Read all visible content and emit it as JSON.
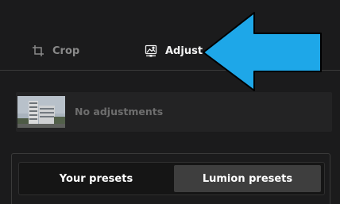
{
  "tabs": {
    "crop": {
      "label": "Crop",
      "icon": "crop-icon"
    },
    "adjust": {
      "label": "Adjust",
      "icon": "image-adjust-icon"
    }
  },
  "adjustments": {
    "status": "No adjustments"
  },
  "presets": {
    "your_label": "Your presets",
    "lumion_label": "Lumion presets",
    "selected": "lumion"
  },
  "colors": {
    "background": "#1b1b1c",
    "accent": "#2f86dd",
    "arrow": "#1ea7e8",
    "selected_segment": "#3e3e3e"
  }
}
